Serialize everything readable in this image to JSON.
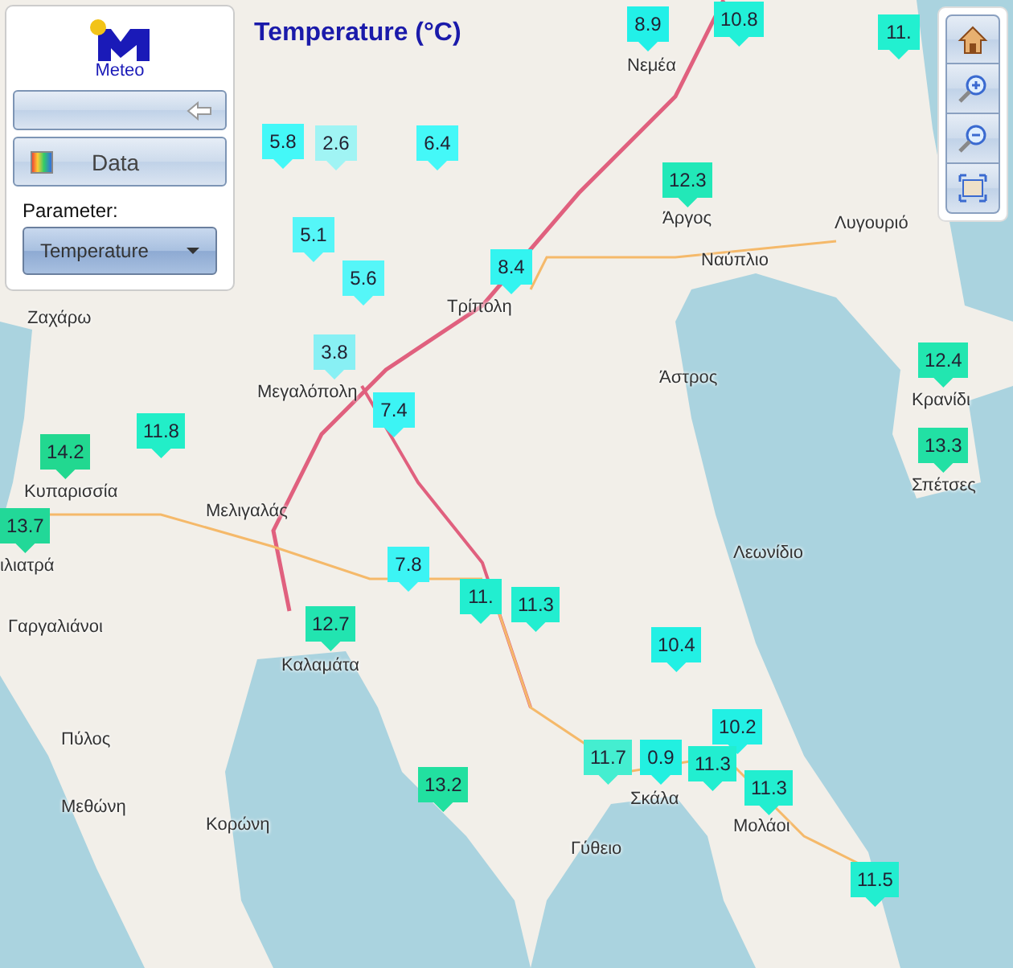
{
  "map_title": "Temperature (°C)",
  "panel": {
    "logo_text": "Meteo",
    "data_button": "Data",
    "parameter_label": "Parameter:",
    "parameter_select": "Temperature"
  },
  "places": [
    {
      "name": "Νεμέα"
    },
    {
      "name": "Άργος"
    },
    {
      "name": "Ναύπλιο"
    },
    {
      "name": "Λυγουριό"
    },
    {
      "name": "Τρίπολη"
    },
    {
      "name": "Ζαχάρω"
    },
    {
      "name": "Μεγαλόπολη"
    },
    {
      "name": "Άστρος"
    },
    {
      "name": "Κρανίδι"
    },
    {
      "name": "Σπέτσες"
    },
    {
      "name": "Κυπαρισσία"
    },
    {
      "name": "Μελιγαλάς"
    },
    {
      "name": "Λεωνίδιο"
    },
    {
      "name": "ιλιατρά"
    },
    {
      "name": "Γαργαλιάνοι"
    },
    {
      "name": "Καλαμάτα"
    },
    {
      "name": "Σκάλα"
    },
    {
      "name": "Πύλος"
    },
    {
      "name": "Μεθώνη"
    },
    {
      "name": "Κορώνη"
    },
    {
      "name": "Γύθειο"
    },
    {
      "name": "Μολάοι"
    }
  ],
  "markers": [
    {
      "value": "8.9",
      "color": "#22f0e8"
    },
    {
      "value": "10.8",
      "color": "#22f0d8"
    },
    {
      "value": "11.",
      "color": "#22f0d0"
    },
    {
      "value": "5.8",
      "color": "#44f8f8"
    },
    {
      "value": "2.6",
      "color": "#a0f4f4"
    },
    {
      "value": "6.4",
      "color": "#44f8f8"
    },
    {
      "value": "5.1",
      "color": "#55f6f8"
    },
    {
      "value": "5.6",
      "color": "#55f6f8"
    },
    {
      "value": "8.4",
      "color": "#33f4f0"
    },
    {
      "value": "12.3",
      "color": "#22e8b8"
    },
    {
      "value": "3.8",
      "color": "#88f0f4"
    },
    {
      "value": "7.4",
      "color": "#3cf4f4"
    },
    {
      "value": "11.8",
      "color": "#22eec8"
    },
    {
      "value": "14.2",
      "color": "#22d890"
    },
    {
      "value": "13.7",
      "color": "#22d898"
    },
    {
      "value": "12.4",
      "color": "#22e6b0"
    },
    {
      "value": "13.3",
      "color": "#22e0a4"
    },
    {
      "value": "7.8",
      "color": "#3cf4f4"
    },
    {
      "value": "11.",
      "color": "#22eed0"
    },
    {
      "value": "11.3",
      "color": "#22eed0"
    },
    {
      "value": "12.7",
      "color": "#22e4b0"
    },
    {
      "value": "10.4",
      "color": "#22f0e4"
    },
    {
      "value": "10.2",
      "color": "#22f0e4"
    },
    {
      "value": "11.7",
      "color": "#44eed0"
    },
    {
      "value": "0.9",
      "color": "#22f0e0"
    },
    {
      "value": "11.3",
      "color": "#22eed0"
    },
    {
      "value": "11.3",
      "color": "#22eed0"
    },
    {
      "value": "13.2",
      "color": "#22e0a0"
    },
    {
      "value": "11.5",
      "color": "#22eed0"
    }
  ]
}
